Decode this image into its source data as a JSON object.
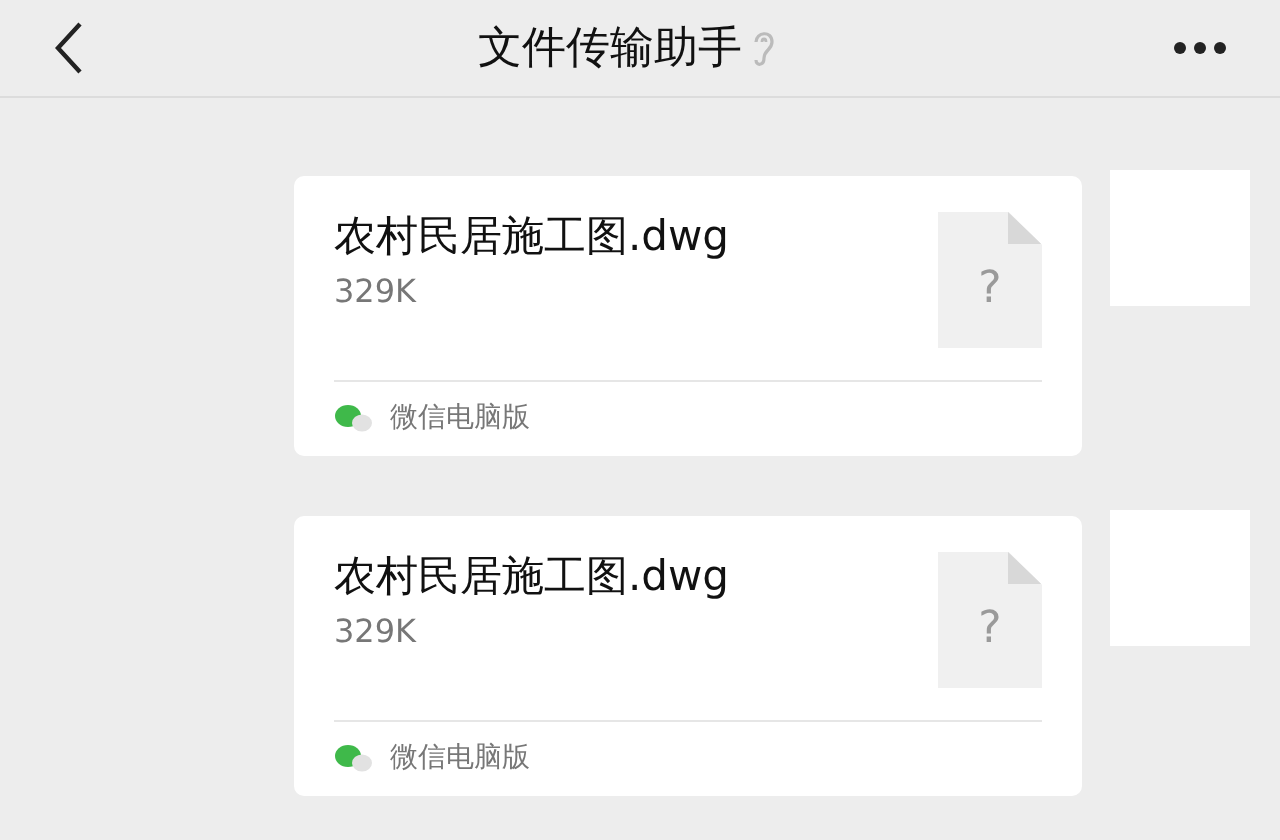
{
  "header": {
    "title": "文件传输助手"
  },
  "messages": [
    {
      "file_name": "农村民居施工图.dwg",
      "file_size": "329K",
      "file_icon_glyph": "?",
      "source": "微信电脑版"
    },
    {
      "file_name": "农村民居施工图.dwg",
      "file_size": "329K",
      "file_icon_glyph": "?",
      "source": "微信电脑版"
    }
  ]
}
